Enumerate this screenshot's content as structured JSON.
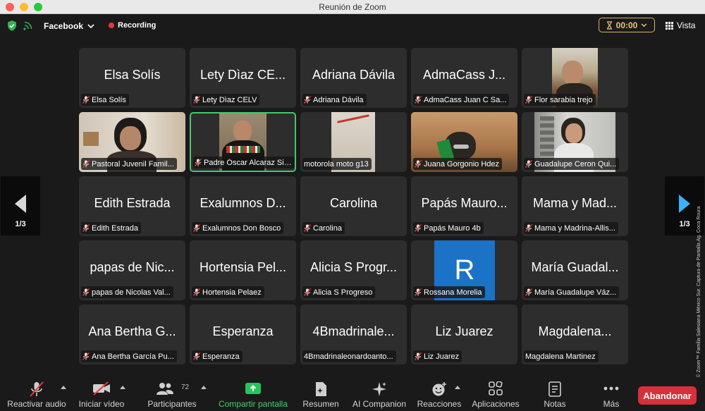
{
  "window": {
    "title": "Reunión de Zoom"
  },
  "topbar": {
    "stream_label": "Facebook",
    "recording_label": "Recording",
    "timer": "00:00",
    "view_label": "Vista"
  },
  "pager": {
    "left_label": "1/3",
    "right_label": "1/3"
  },
  "participants": [
    {
      "display": "Elsa Solís",
      "name": "Elsa Solís"
    },
    {
      "display": "Lety Dìaz CE...",
      "name": "Lety Dìaz CELV"
    },
    {
      "display": "Adriana Dávila",
      "name": "Adriana Dávila"
    },
    {
      "display": "AdmaCass J...",
      "name": "AdmaCass Juan C Sa..."
    },
    {
      "display": "",
      "name": "Flor sarabia trejo"
    },
    {
      "display": "",
      "name": "Pastoral Juvenil Famil..."
    },
    {
      "display": "",
      "name": "Padre Óscar Alcaraz Silv..."
    },
    {
      "display": "",
      "name": "motorola moto g13"
    },
    {
      "display": "",
      "name": "Juana Gorgonio Hdez"
    },
    {
      "display": "",
      "name": "Guadalupe Ceron Qui..."
    },
    {
      "display": "Edith Estrada",
      "name": "Edith Estrada"
    },
    {
      "display": "Exalumnos D...",
      "name": "Exalumnos Don Bosco"
    },
    {
      "display": "Carolina",
      "name": "Carolina"
    },
    {
      "display": "Papás Mauro...",
      "name": "Papás Mauro 4b"
    },
    {
      "display": "Mama y Mad...",
      "name": "Mama y Madrina-Allis..."
    },
    {
      "display": "papas de Nic...",
      "name": "papas de Nicolas Val..."
    },
    {
      "display": "Hortensia Pel...",
      "name": "Hortensia Pelaez"
    },
    {
      "display": "Alicia S Progr...",
      "name": "Alicia S Progreso"
    },
    {
      "display": "",
      "name": "Rossana Morelia",
      "avatar_letter": "R"
    },
    {
      "display": "María Guadal...",
      "name": "María Guadalupe Váz..."
    },
    {
      "display": "Ana Bertha G...",
      "name": "Ana Bertha García Pu..."
    },
    {
      "display": "Esperanza",
      "name": "Esperanza"
    },
    {
      "display": "4Bmadrinale...",
      "name": "4Bmadrinaleonardoanto..."
    },
    {
      "display": "Liz Juarez",
      "name": "Liz Juarez"
    },
    {
      "display": "Magdalena...",
      "name": "Magdalena Martinez"
    }
  ],
  "watermark": "Cortesía © Zoom™ Familia Salesiana México Sur. Captura de Pantalla Ag. Coca Roura",
  "toolbar": {
    "mute_label": "Reactivar audio",
    "video_label": "Iniciar vídeo",
    "participants_label": "Participantes",
    "participants_count": "72",
    "share_label": "Compartir pantalla",
    "summary_label": "Resumen",
    "ai_label": "AI Companion",
    "reactions_label": "Reacciones",
    "apps_label": "Aplicaciones",
    "notes_label": "Notas",
    "more_label": "Más",
    "leave_label": "Abandonar"
  },
  "colors": {
    "accent_green": "#46c66a",
    "leave_red": "#d8303b",
    "timer_gold": "#e9c577",
    "avatar_blue": "#1b72c6"
  }
}
